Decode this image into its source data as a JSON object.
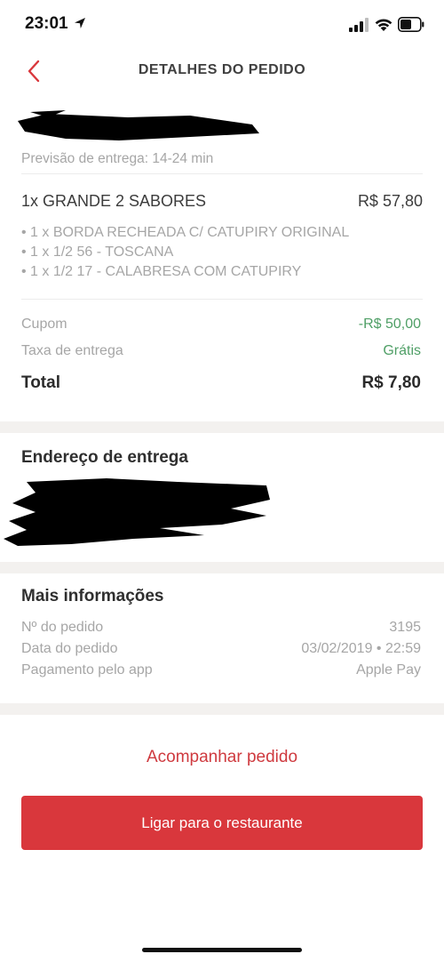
{
  "status_bar": {
    "time": "23:01"
  },
  "nav": {
    "title": "DETALHES DO PEDIDO"
  },
  "order": {
    "eta": "Previsão de entrega: 14-24 min",
    "item": {
      "name": "1x GRANDE  2 SABORES",
      "price": "R$ 57,80"
    },
    "options": [
      "• 1 x BORDA RECHEADA C/ CATUPIRY ORIGINAL",
      "• 1 x 1/2 56 - TOSCANA",
      "• 1 x 1/2 17 - CALABRESA  COM CATUPIRY"
    ],
    "coupon_label": "Cupom",
    "coupon_value": "-R$ 50,00",
    "delivery_fee_label": "Taxa de entrega",
    "delivery_fee_value": "Grátis",
    "total_label": "Total",
    "total_value": "R$ 7,80"
  },
  "address": {
    "title": "Endereço de entrega"
  },
  "more_info": {
    "title": "Mais informações",
    "rows": [
      {
        "label": "Nº do pedido",
        "value": "3195"
      },
      {
        "label": "Data do pedido",
        "value": "03/02/2019 • 22:59"
      },
      {
        "label": "Pagamento pelo app",
        "value": "Apple Pay"
      }
    ]
  },
  "actions": {
    "track_label": "Acompanhar pedido",
    "call_label": "Ligar para o restaurante"
  },
  "colors": {
    "accent": "#d9373c",
    "green": "#4f9f66",
    "muted": "#a6a6a6"
  }
}
